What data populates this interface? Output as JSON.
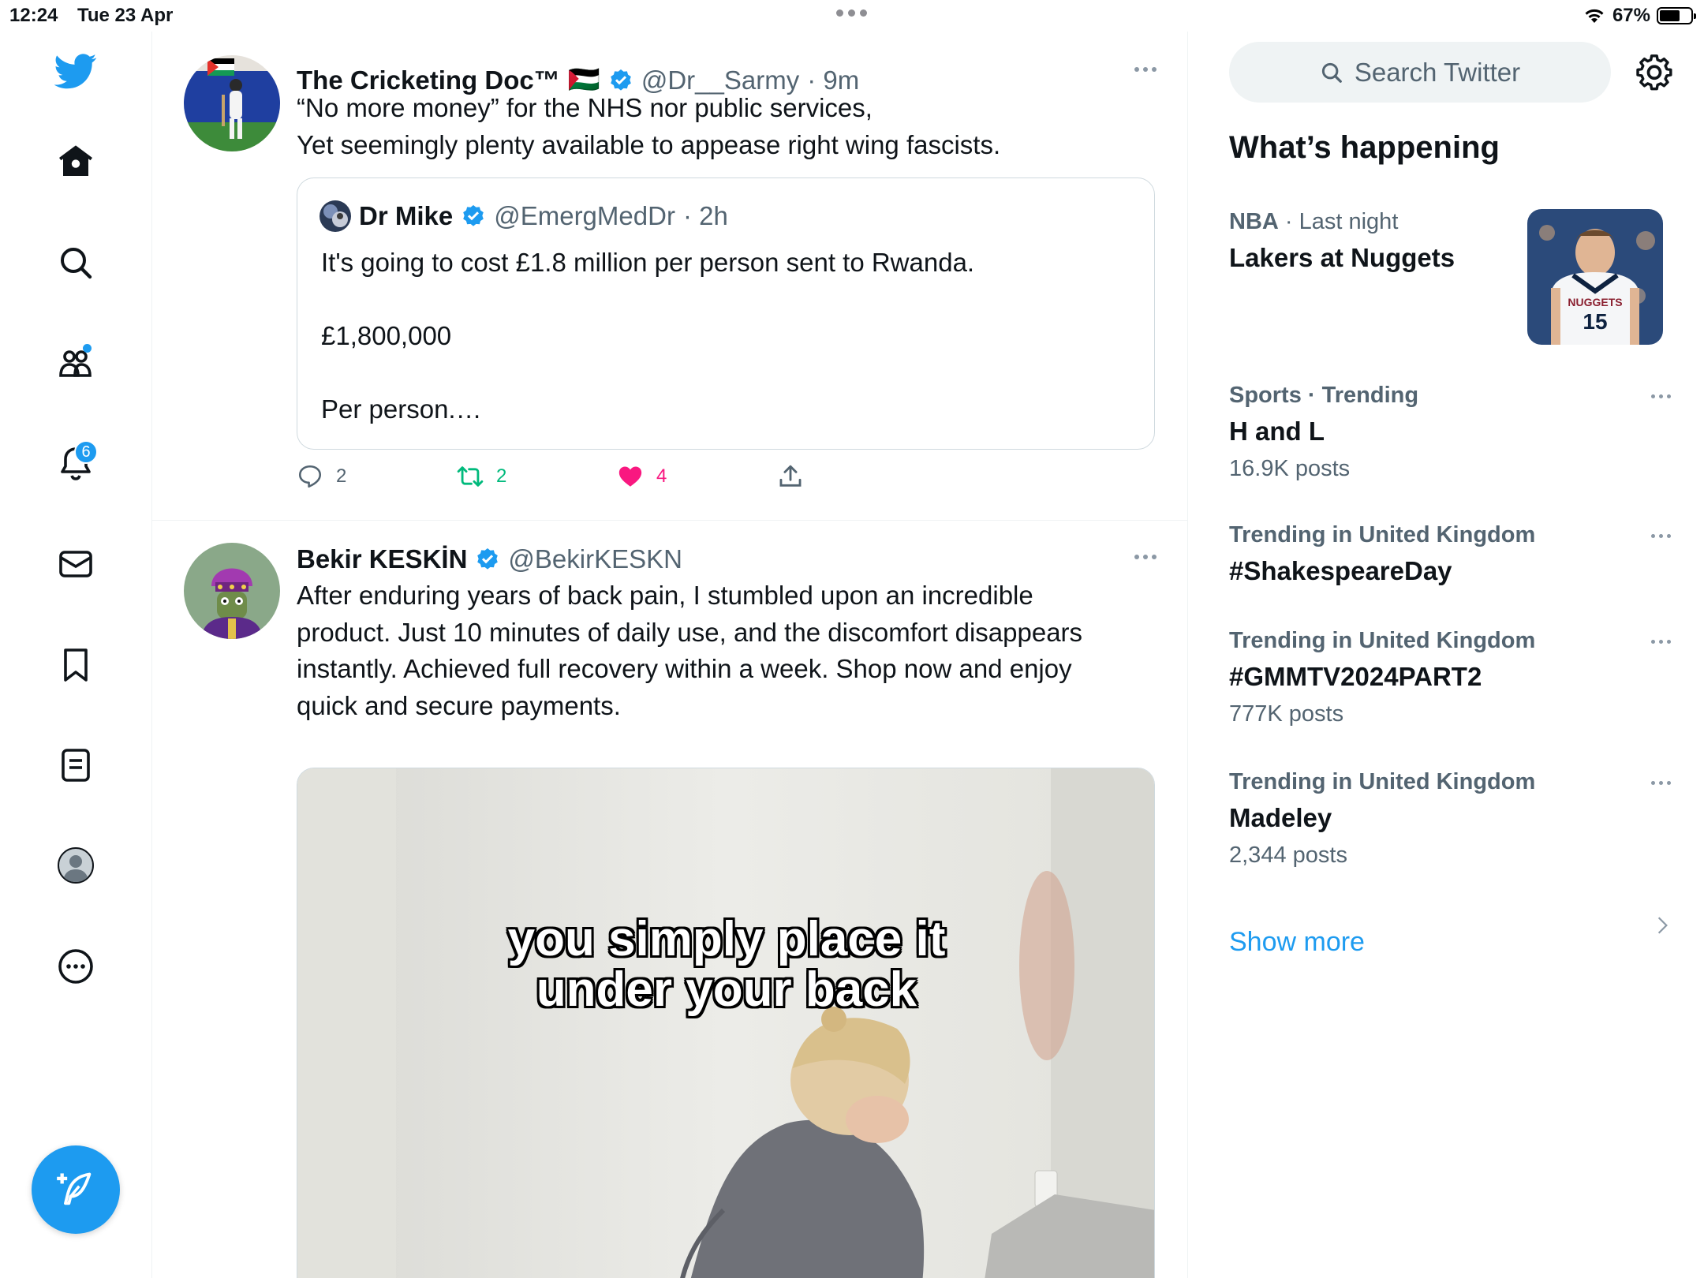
{
  "status_bar": {
    "time": "12:24",
    "date": "Tue 23 Apr",
    "battery": "67%",
    "battery_level": 0.67
  },
  "nav": {
    "notifications_badge": "6",
    "items": [
      "twitter-logo",
      "home",
      "explore",
      "communities",
      "notifications",
      "messages",
      "bookmarks",
      "lists",
      "profile",
      "more"
    ]
  },
  "tweets": [
    {
      "name": "The Cricketing Doc™",
      "flag": "🇵🇸",
      "handle": "@Dr__Sarmy",
      "time": "· 9m",
      "lines": [
        "“No more money” for the NHS nor public services,",
        "Yet seemingly plenty available to appease right wing fascists."
      ],
      "quote": {
        "name": "Dr Mike",
        "handle": "@EmergMedDr",
        "time": "· 2h",
        "lines": [
          "It's going to cost £1.8 million per person sent to Rwanda.",
          "£1,800,000",
          "Per person.…"
        ]
      },
      "replies": "2",
      "retweets": "2",
      "likes": "4"
    },
    {
      "name": "Bekir KESKİN",
      "handle": "@BekirKESKN",
      "text": "After enduring years of back pain, I stumbled upon an incredible product. Just 10 minutes of daily use, and the discomfort disappears instantly. Achieved full recovery within a week. Shop now and enjoy quick and secure payments.",
      "media_caption_1": "you simply place it",
      "media_caption_2": "under your back"
    }
  ],
  "sidebar": {
    "search_placeholder": "Search Twitter",
    "section_title": "What’s happening",
    "trends": [
      {
        "meta_a": "NBA",
        "meta_b": " · Last night",
        "title": "Lakers at Nuggets",
        "count": ""
      },
      {
        "meta": "Sports · Trending",
        "title": "H and L",
        "count": "16.9K posts"
      },
      {
        "meta": "Trending in United Kingdom",
        "title": "#ShakespeareDay",
        "count": ""
      },
      {
        "meta": "Trending in United Kingdom",
        "title": "#GMMTV2024PART2",
        "count": "777K posts"
      },
      {
        "meta": "Trending in United Kingdom",
        "title": "Madeley",
        "count": "2,344 posts"
      }
    ],
    "show_more": "Show more",
    "jersey_text": "NUGGETS",
    "jersey_number": "15"
  },
  "colors": {
    "accent": "#1d9bf0",
    "like": "#f91880",
    "retweet": "#00ba7c",
    "secondary_text": "#536471"
  }
}
